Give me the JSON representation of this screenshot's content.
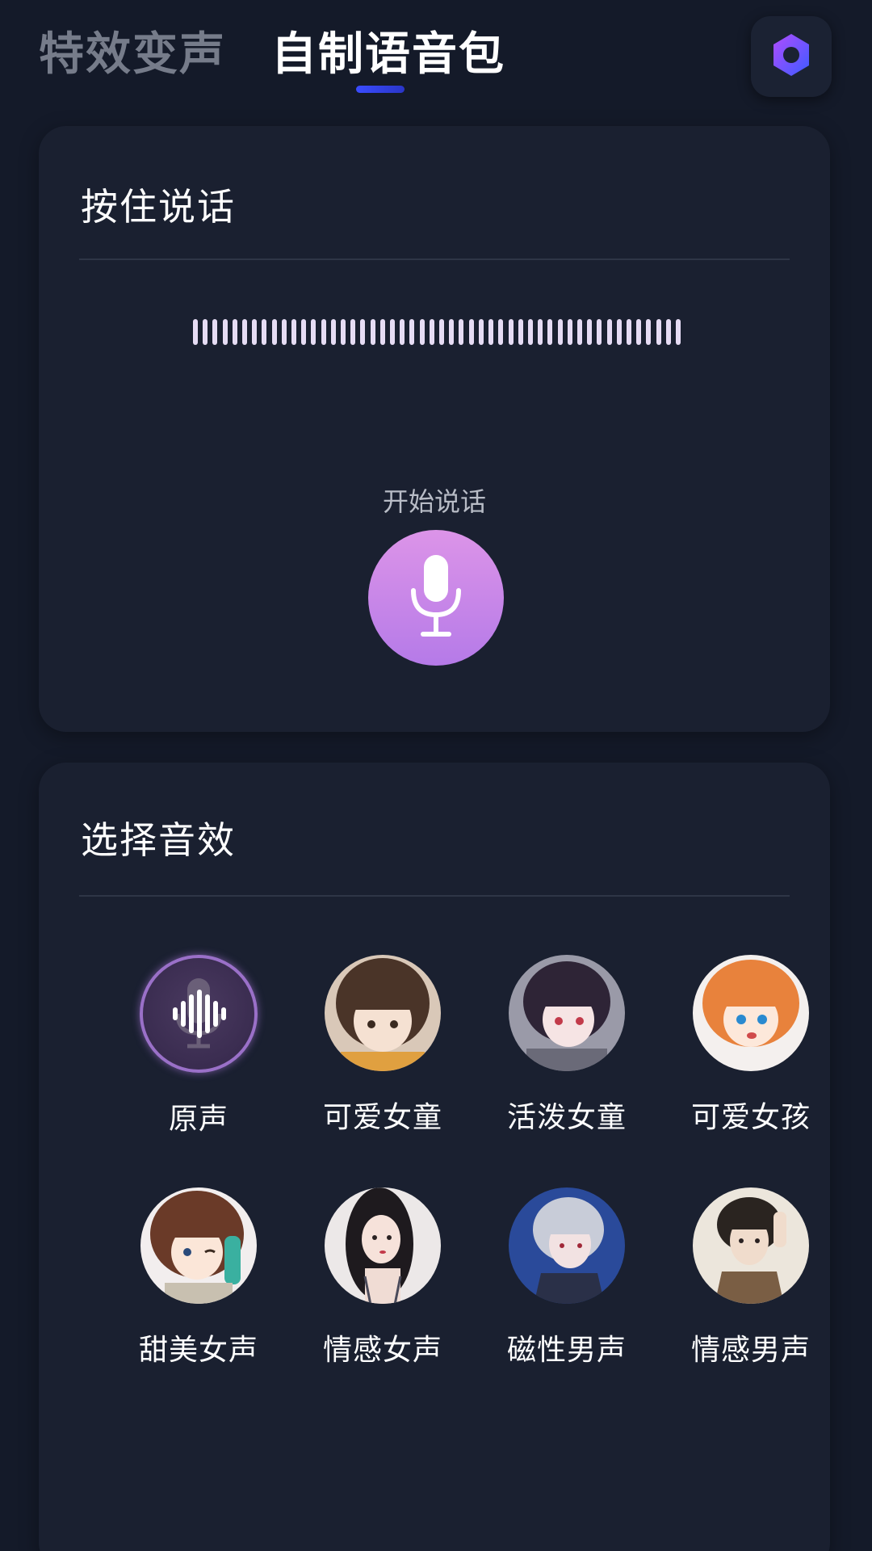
{
  "tabs": {
    "effects_tab": "特效变声",
    "custom_pack_tab": "自制语音包"
  },
  "record_card": {
    "title": "按住说话",
    "start_label": "开始说话",
    "mic_icon": "microphone-icon"
  },
  "effects_card": {
    "title": "选择音效",
    "items": [
      {
        "label": "原声",
        "icon": "sound-wave-icon"
      },
      {
        "label": "可爱女童"
      },
      {
        "label": "活泼女童"
      },
      {
        "label": "可爱女孩"
      },
      {
        "label": "甜美女声"
      },
      {
        "label": "情感女声"
      },
      {
        "label": "磁性男声"
      },
      {
        "label": "情感男声"
      }
    ]
  },
  "colors": {
    "background": "#141a29",
    "card": "#1a2030",
    "tab_indicator": "#3a4cff",
    "mic_gradient_top": "#dc94e8",
    "mic_gradient_bottom": "#b57ae8",
    "selected_ring": "#9a70c8"
  }
}
